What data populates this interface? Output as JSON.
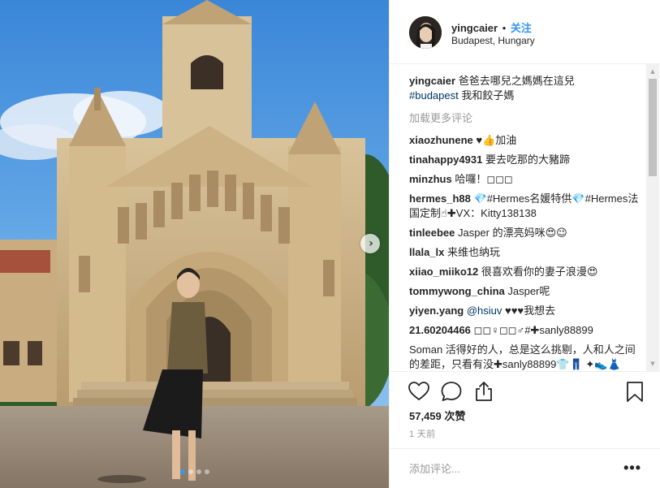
{
  "post": {
    "username": "yingcaier",
    "separator": "•",
    "follow_label": "关注",
    "location": "Budapest, Hungary",
    "caption": {
      "username": "yingcaier",
      "text": " 爸爸去哪兒之媽媽在這兒",
      "hashtag": "#budapest",
      "text2": " 我和餃子媽"
    },
    "load_more_label": "加载更多评论",
    "comments": [
      {
        "user": "xiaozhunene",
        "text": " ♥👍加油"
      },
      {
        "user": "tinahappy4931",
        "text": " 要去吃那的大豬蹄"
      },
      {
        "user": "minzhus",
        "text": " 哈囉！◻◻◻"
      },
      {
        "user": "hermes_h88",
        "text": " 💎#Hermes名媛特供💎#Hermes法国定制☝✚VX：Kitty138138"
      },
      {
        "user": "tinleebee",
        "text": " Jasper 的漂亮妈咪😍😉"
      },
      {
        "user": "llala_lx",
        "text": " 来维也纳玩"
      },
      {
        "user": "xiiao_miiko12",
        "text": " 很喜欢看你的妻子浪漫😍"
      },
      {
        "user": "tommywong_china",
        "text": " Jasper呢"
      },
      {
        "user": "yiyen.yang",
        "mention": " @hsiuv",
        "text": " ♥♥♥我想去"
      },
      {
        "user": "21.60204466",
        "text": " ◻◻♀◻◻♂#✚sanly88899"
      },
      {
        "user": "",
        "text": "Soman 活得好的人，总是这么挑剔，人和人之间的差距，只看有没✚sanly88899👕👖 ✦👟👗"
      }
    ],
    "likes": "57,459 次赞",
    "time_ago": "1 天前",
    "add_comment_placeholder": "添加评论...",
    "more_label": "•••",
    "icons": {
      "like": "heart-icon",
      "comment": "comment-bubble-icon",
      "share": "share-icon",
      "save": "bookmark-icon",
      "next": "chevron-right-icon"
    },
    "carousel": {
      "total": 4,
      "active": 1
    },
    "colors": {
      "link": "#3897f0",
      "hashtag": "#003569",
      "muted": "#999999"
    }
  }
}
